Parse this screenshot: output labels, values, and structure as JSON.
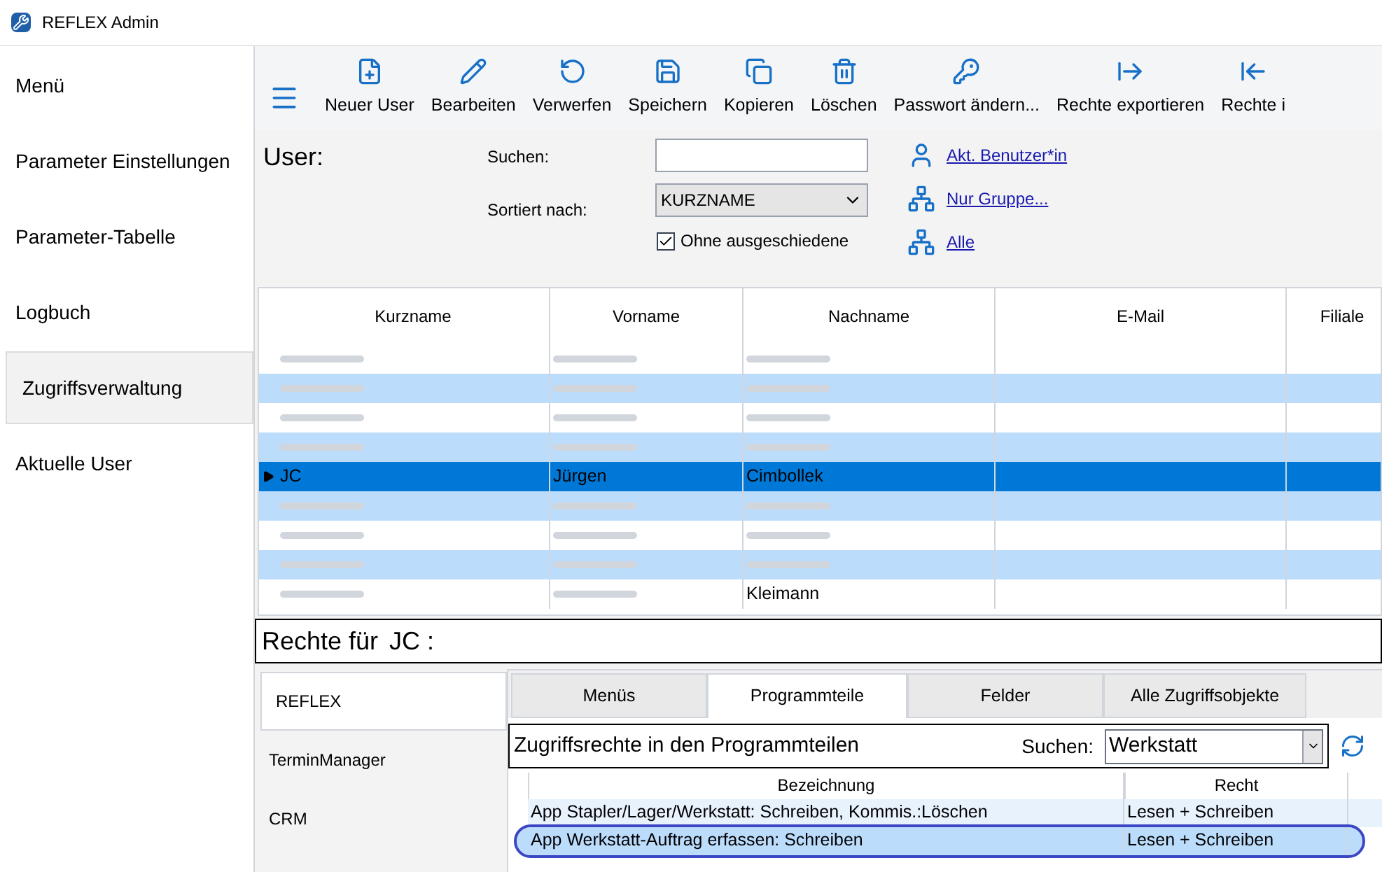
{
  "window": {
    "title": "REFLEX Admin"
  },
  "sidebar": {
    "items": [
      {
        "label": "Menü",
        "selected": false
      },
      {
        "label": "Parameter Einstellungen",
        "selected": false
      },
      {
        "label": "Parameter-Tabelle",
        "selected": false
      },
      {
        "label": "Logbuch",
        "selected": false
      },
      {
        "label": "Zugriffsverwaltung",
        "selected": true
      },
      {
        "label": "Aktuelle User",
        "selected": false
      }
    ]
  },
  "toolbar": [
    {
      "label": "Neuer User",
      "kind": "new"
    },
    {
      "label": "Bearbeiten",
      "kind": "edit"
    },
    {
      "label": "Verwerfen",
      "kind": "discard"
    },
    {
      "label": "Speichern",
      "kind": "save"
    },
    {
      "label": "Kopieren",
      "kind": "copy"
    },
    {
      "label": "Löschen",
      "kind": "delete"
    },
    {
      "label": "Passwort ändern...",
      "kind": "password"
    },
    {
      "label": "Rechte exportieren",
      "kind": "export"
    },
    {
      "label": "Rechte i",
      "kind": "import"
    }
  ],
  "user_panel": {
    "title": "User:",
    "search_label": "Suchen:",
    "sort_label": "Sortiert nach:",
    "sort": {
      "value": "KURZNAME"
    },
    "exclude_retired": {
      "label": "Ohne ausgeschiedene",
      "checked": true
    },
    "links": [
      {
        "label": "Akt. Benutzer*in",
        "kind": "user"
      },
      {
        "label": "Nur Gruppe...",
        "kind": "group"
      },
      {
        "label": "Alle",
        "kind": "all"
      }
    ]
  },
  "user_table": {
    "columns": [
      "Kurzname",
      "Vorname",
      "Nachname",
      "E-Mail",
      "Filiale"
    ],
    "rows": [
      {
        "cells": [
          null,
          null,
          null
        ],
        "selected": false
      },
      {
        "cells": [
          null,
          null,
          null
        ],
        "selected": false
      },
      {
        "cells": [
          null,
          null,
          null
        ],
        "selected": false
      },
      {
        "cells": [
          null,
          null,
          null
        ],
        "selected": false
      },
      {
        "cells": [
          "JC",
          "Jürgen",
          "Cimbollek"
        ],
        "selected": true
      },
      {
        "cells": [
          null,
          null,
          null
        ],
        "selected": false
      },
      {
        "cells": [
          null,
          null,
          null
        ],
        "selected": false
      },
      {
        "cells": [
          null,
          null,
          null
        ],
        "selected": false
      },
      {
        "cells": [
          null,
          null,
          "Kleimann"
        ],
        "selected": false
      }
    ]
  },
  "rights": {
    "title": "Rechte für",
    "user": "JC :",
    "apps": [
      {
        "label": "REFLEX",
        "selected": true
      },
      {
        "label": "TerminManager",
        "selected": false
      },
      {
        "label": "CRM",
        "selected": false
      }
    ],
    "tabs": [
      {
        "label": "Menüs",
        "selected": false
      },
      {
        "label": "Programmteile",
        "selected": true
      },
      {
        "label": "Felder",
        "selected": false
      },
      {
        "label": "Alle Zugriffsobjekte",
        "selected": false
      }
    ],
    "heading": "Zugriffsrechte in den Programmteilen",
    "search_label": "Suchen:",
    "search": {
      "value": "Werkstatt"
    },
    "columns": [
      "Bezeichnung",
      "Recht"
    ],
    "rows": [
      {
        "cells": [
          "App Stapler/Lager/Werkstatt: Schreiben, Kommis.:Löschen",
          "Lesen + Schreiben"
        ],
        "selected": false,
        "circled": false
      },
      {
        "cells": [
          "App Werkstatt-Auftrag erfassen: Schreiben",
          "Lesen + Schreiben"
        ],
        "selected": true,
        "circled": true
      }
    ]
  }
}
